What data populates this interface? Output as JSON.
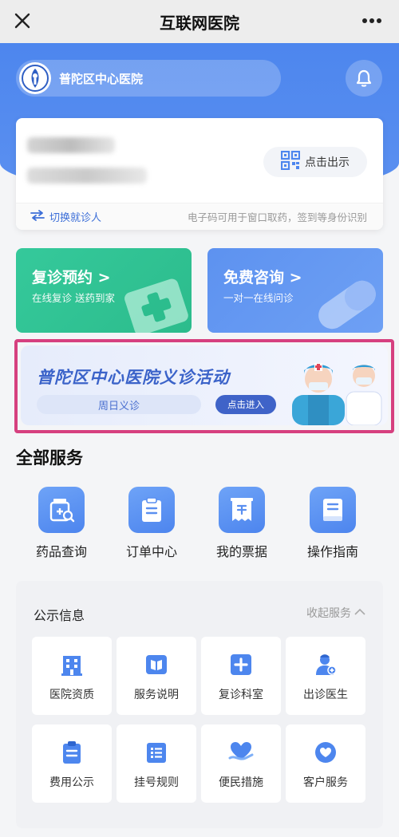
{
  "nav": {
    "title": "互联网医院"
  },
  "header": {
    "hospital_name": "普陀区中心医院"
  },
  "patient_card": {
    "show_code_label": "点击出示",
    "switch_label": "切换就诊人",
    "hint": "电子码可用于窗口取药，签到等身份识别"
  },
  "features": [
    {
      "title": "复诊预约",
      "subtitle": "在线复诊 送药到家"
    },
    {
      "title": "免费咨询",
      "subtitle": "一对一在线问诊"
    }
  ],
  "banner": {
    "title": "普陀区中心医院义诊活动",
    "pill": "周日义诊",
    "enter": "点击进入"
  },
  "services": {
    "title": "全部服务",
    "items": [
      {
        "label": "药品查询",
        "icon": "medicine-search-icon"
      },
      {
        "label": "订单中心",
        "icon": "clipboard-icon"
      },
      {
        "label": "我的票据",
        "icon": "receipt-icon"
      },
      {
        "label": "操作指南",
        "icon": "guide-book-icon"
      }
    ]
  },
  "info": {
    "title": "公示信息",
    "collapse": "收起服务",
    "items": [
      {
        "label": "医院资质",
        "icon": "building-icon"
      },
      {
        "label": "服务说明",
        "icon": "book-icon"
      },
      {
        "label": "复诊科室",
        "icon": "medical-cross-icon"
      },
      {
        "label": "出诊医生",
        "icon": "doctor-icon"
      },
      {
        "label": "费用公示",
        "icon": "clipboard-list-icon"
      },
      {
        "label": "挂号规则",
        "icon": "rules-list-icon"
      },
      {
        "label": "便民措施",
        "icon": "heart-hand-icon"
      },
      {
        "label": "客户服务",
        "icon": "customer-service-icon"
      }
    ]
  },
  "colors": {
    "primary": "#4d86ee",
    "green": "#2ec394",
    "highlight": "#d6407f"
  }
}
